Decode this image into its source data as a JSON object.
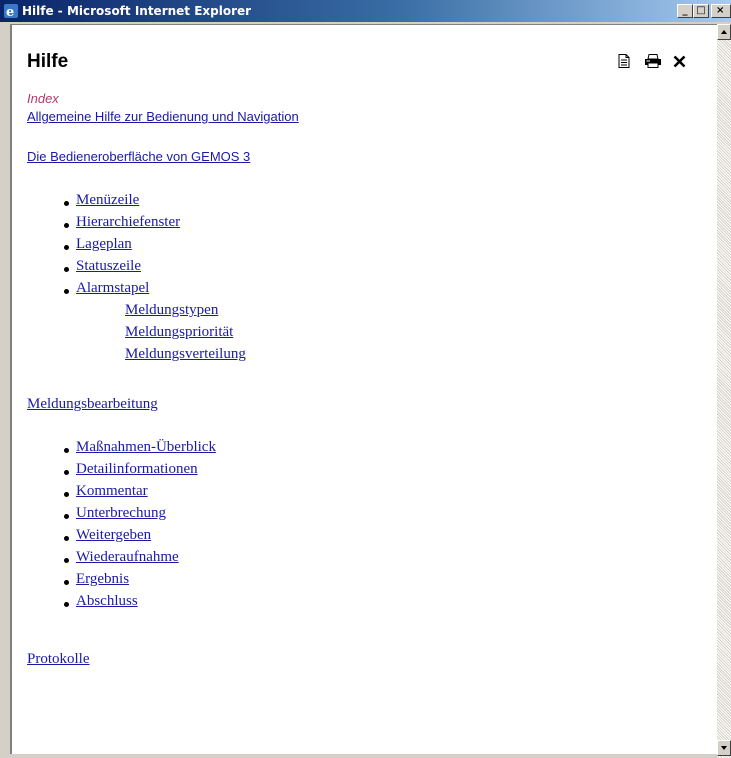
{
  "window": {
    "title": "Hilfe - Microsoft Internet Explorer",
    "min_glyph": "_",
    "max_glyph": "□",
    "close_glyph": "×"
  },
  "page": {
    "title": "Hilfe",
    "index_label": "Index",
    "general_help_link": "Allgemeine Hilfe zur Bedienung und Navigation",
    "close_glyph": "×"
  },
  "sections": {
    "ui": {
      "heading": "Die Bedieneroberfläche von GEMOS 3",
      "items": [
        "Menüzeile",
        "Hierarchiefenster",
        "Lageplan",
        "Statuszeile",
        "Alarmstapel"
      ],
      "subitems": [
        "Meldungstypen",
        "Meldungspriorität",
        "Meldungsverteilung"
      ]
    },
    "processing": {
      "heading": "Meldungsbearbeitung",
      "items": [
        "Maßnahmen-Überblick",
        "Detailinformationen",
        "Kommentar",
        "Unterbrechung",
        "Weitergeben",
        "Wiederaufnahme",
        "Ergebnis",
        "Abschluss"
      ]
    },
    "protocols": {
      "heading": "Protokolle"
    }
  },
  "icons": {
    "app": "ie-icon",
    "document": "document-icon",
    "print": "print-icon",
    "close": "close-icon"
  },
  "colors": {
    "link": "#1a1aa6",
    "index_label": "#b03a6b",
    "titlebar_start": "#0a246a",
    "titlebar_end": "#a6caf0",
    "chrome": "#d4d0c8"
  }
}
